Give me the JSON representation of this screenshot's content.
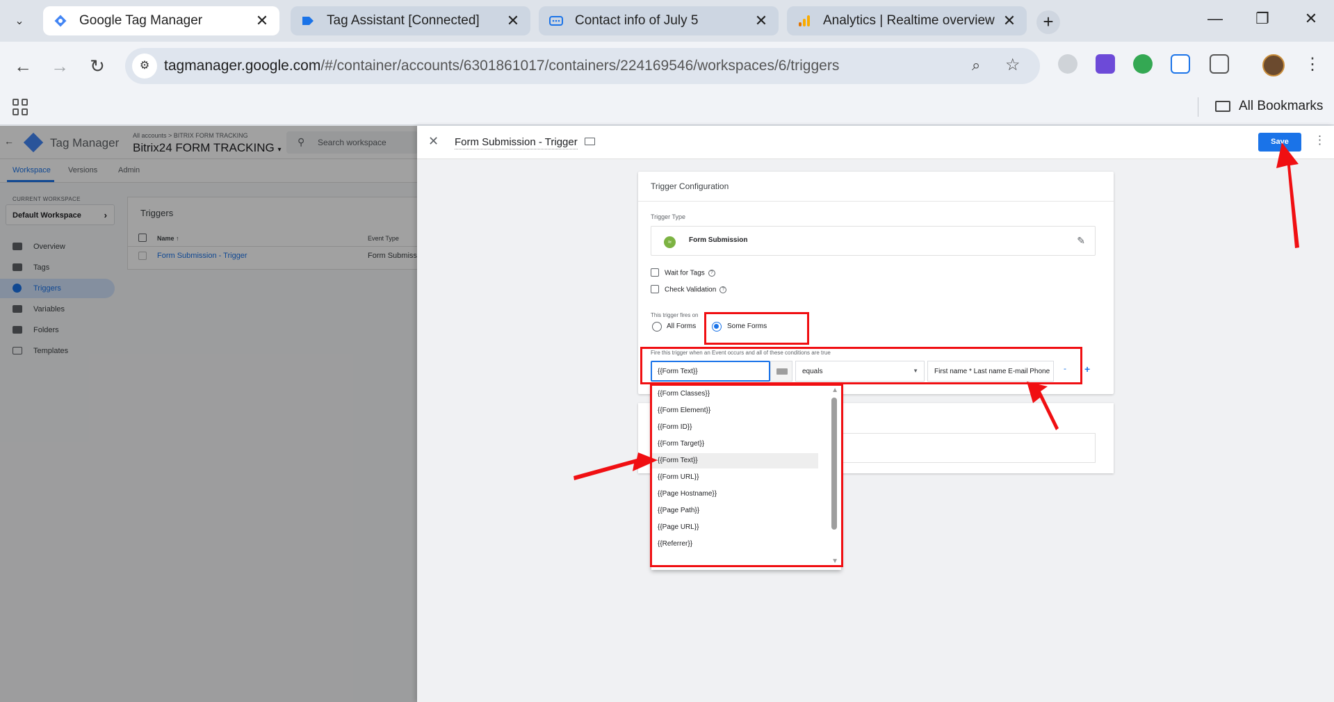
{
  "browser": {
    "tabs": [
      {
        "title": "Google Tag Manager",
        "active": true
      },
      {
        "title": "Tag Assistant [Connected]",
        "active": false
      },
      {
        "title": "Contact info of July 5",
        "active": false
      },
      {
        "title": "Analytics | Realtime overview",
        "active": false
      }
    ],
    "url_host": "tagmanager.google.com",
    "url_path": "/#/container/accounts/6301861017/containers/224169546/workspaces/6/triggers",
    "bookmarks_label": "All Bookmarks"
  },
  "gtm": {
    "product_name": "Tag Manager",
    "breadcrumb": "All accounts > BITRIX FORM TRACKING",
    "container_name": "Bitrix24 FORM TRACKING",
    "search_placeholder": "Search workspace",
    "tabs": [
      "Workspace",
      "Versions",
      "Admin"
    ],
    "current_workspace_label": "CURRENT WORKSPACE",
    "current_workspace": "Default Workspace",
    "nav": [
      {
        "label": "Overview",
        "icon": "overview-icon"
      },
      {
        "label": "Tags",
        "icon": "tag-icon"
      },
      {
        "label": "Triggers",
        "icon": "trigger-icon",
        "selected": true
      },
      {
        "label": "Variables",
        "icon": "variables-icon"
      },
      {
        "label": "Folders",
        "icon": "folder-icon"
      },
      {
        "label": "Templates",
        "icon": "template-icon"
      }
    ],
    "triggers_title": "Triggers",
    "columns": [
      "Name ↑",
      "Event Type"
    ],
    "rows": [
      {
        "name": "Form Submission - Trigger",
        "event_type": "Form Submissi"
      }
    ]
  },
  "panel": {
    "title": "Form Submission - Trigger",
    "save_label": "Save",
    "config_title": "Trigger Configuration",
    "trigger_type_label": "Trigger Type",
    "trigger_type": "Form Submission",
    "wait_for_tags": "Wait for Tags",
    "check_validation": "Check Validation",
    "fires_on_label": "This trigger fires on",
    "all_forms": "All Forms",
    "some_forms": "Some Forms",
    "condition_label": "Fire this trigger when an Event occurs and all of these conditions are true",
    "condition_variable": "{{Form Text}}",
    "condition_operator": "equals",
    "condition_value": "First name * Last name E-mail Phone",
    "minus": "-",
    "plus": "+",
    "dropdown_items": [
      "{{Form Classes}}",
      "{{Form Element}}",
      "{{Form ID}}",
      "{{Form Target}}",
      "{{Form Text}}",
      "{{Form URL}}",
      "{{Page Hostname}}",
      "{{Page Path}}",
      "{{Page URL}}",
      "{{Referrer}}"
    ],
    "dropdown_highlighted": "{{Form Text}}"
  },
  "colors": {
    "accent": "#1a73e8",
    "annotation": "#f00f12",
    "trigger_icon": "#7cb342"
  }
}
